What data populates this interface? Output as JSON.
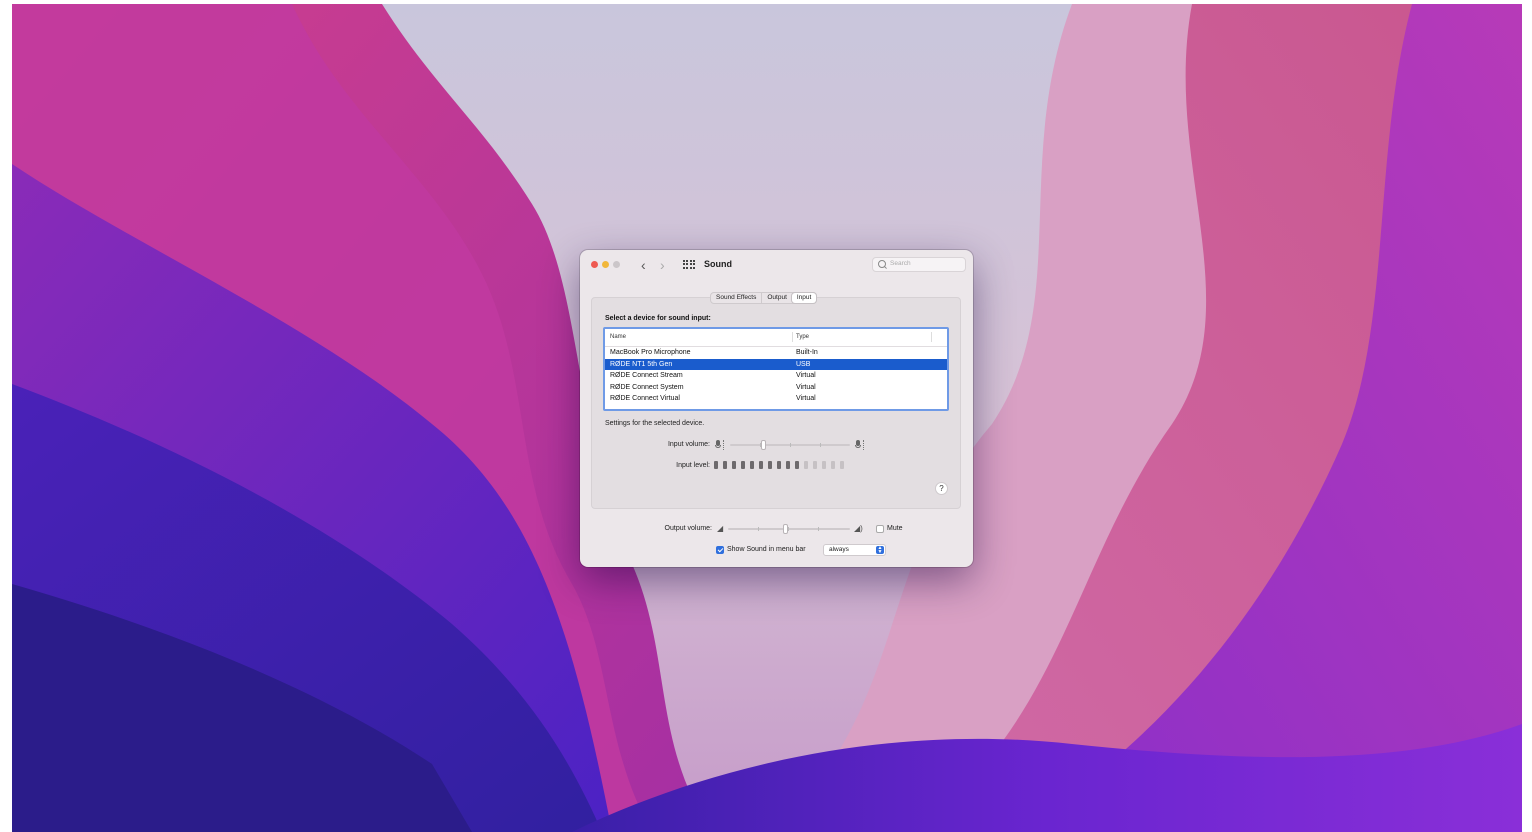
{
  "window": {
    "title": "Sound",
    "search_placeholder": "Search"
  },
  "tabs": [
    {
      "label": "Sound Effects",
      "active": false
    },
    {
      "label": "Output",
      "active": false
    },
    {
      "label": "Input",
      "active": true
    }
  ],
  "input": {
    "heading": "Select a device for sound input:",
    "columns": [
      "Name",
      "Type"
    ],
    "devices": [
      {
        "name": "MacBook Pro Microphone",
        "type": "Built-In",
        "selected": false
      },
      {
        "name": "RØDE NT1 5th Gen",
        "type": "USB",
        "selected": true
      },
      {
        "name": "RØDE Connect Stream",
        "type": "Virtual",
        "selected": false
      },
      {
        "name": "RØDE Connect System",
        "type": "Virtual",
        "selected": false
      },
      {
        "name": "RØDE Connect Virtual",
        "type": "Virtual",
        "selected": false
      }
    ],
    "settings_label": "Settings for the selected device.",
    "volume_label": "Input volume:",
    "volume_level": 0.27,
    "level_label": "Input level:",
    "level_segments_total": 15,
    "level_segments_lit": 10
  },
  "output": {
    "volume_label": "Output volume:",
    "volume_level": 0.47,
    "mute_label": "Mute",
    "muted": false
  },
  "menubar": {
    "show_label": "Show Sound in menu bar",
    "checked": true,
    "option": "always"
  },
  "help": "?",
  "colors": {
    "selection": "#1a5ccd",
    "accent": "#2f6fdd",
    "list_focus_ring": "#6f9ae6"
  }
}
